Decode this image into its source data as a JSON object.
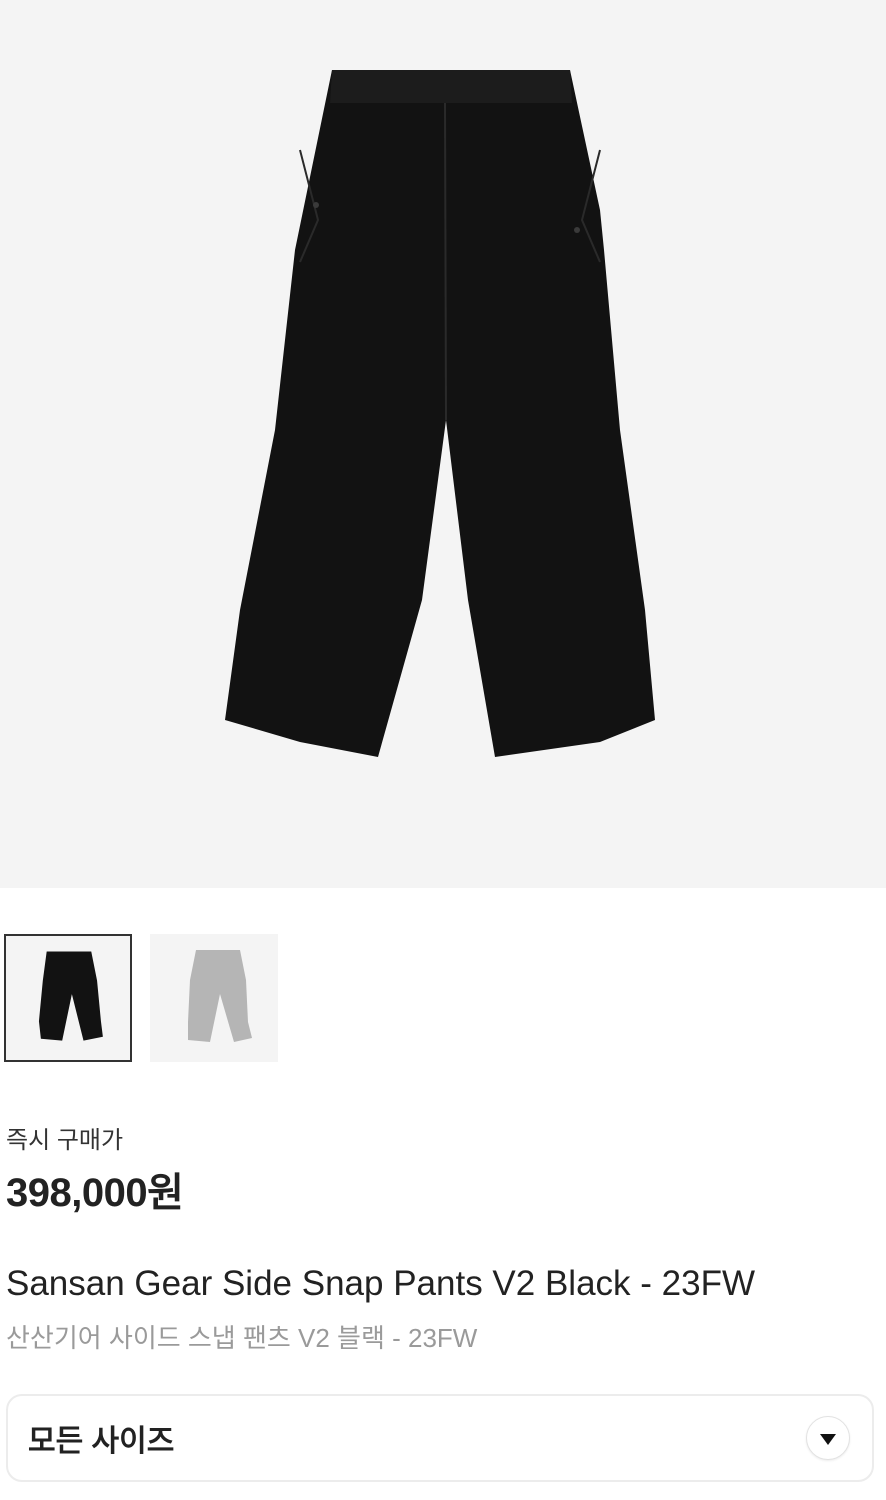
{
  "product": {
    "images": [
      {
        "icon": "black-pants-image",
        "selected": true
      },
      {
        "icon": "gray-pants-image",
        "selected": false
      }
    ],
    "price_label": "즉시 구매가",
    "price": "398,000원",
    "name_en": "Sansan Gear Side Snap Pants V2 Black - 23FW",
    "name_ko": "산산기어 사이드 스냅 팬츠 V2 블랙 - 23FW"
  },
  "size_selector": {
    "label": "모든 사이즈",
    "icon": "chevron-down-icon"
  },
  "colors": {
    "pants_black": "#121212",
    "pants_gray": "#b5b5b5",
    "image_bg": "#f4f4f4"
  }
}
